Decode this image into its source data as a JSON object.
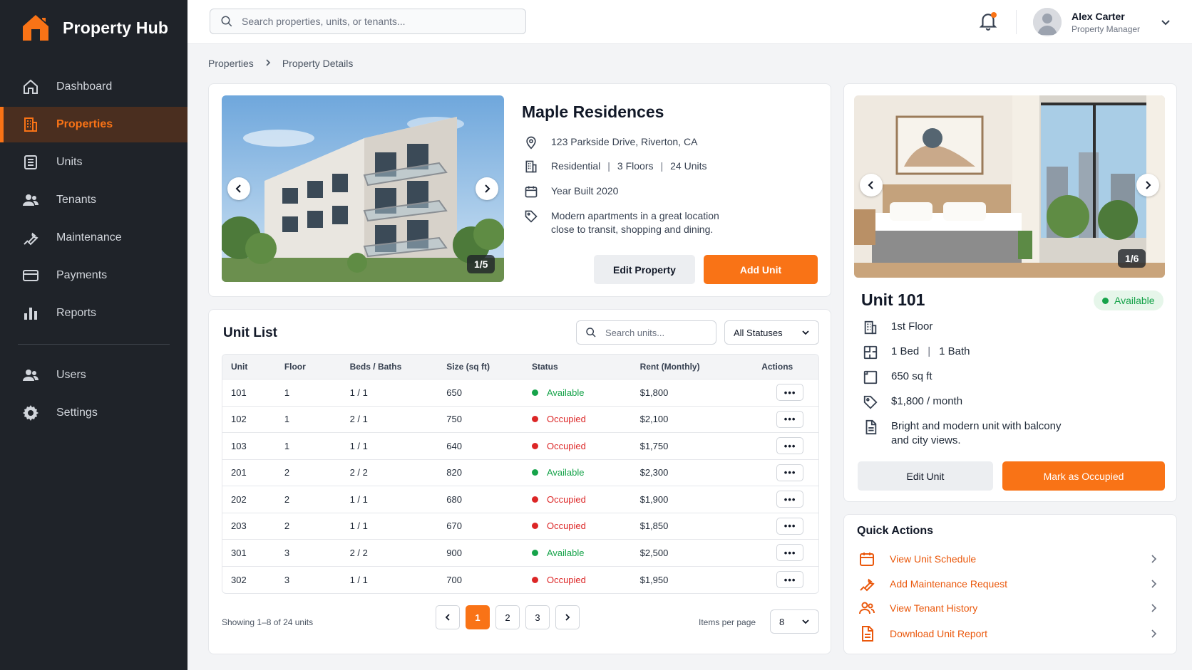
{
  "app": {
    "name": "Property Hub",
    "accent": "#f97316"
  },
  "sidebar": {
    "items": [
      {
        "label": "Dashboard",
        "icon": "home-icon"
      },
      {
        "label": "Properties",
        "icon": "building-icon",
        "active": true
      },
      {
        "label": "Units",
        "icon": "units-icon"
      },
      {
        "label": "Tenants",
        "icon": "tenants-icon"
      },
      {
        "label": "Maintenance",
        "icon": "wrench-icon"
      },
      {
        "label": "Payments",
        "icon": "credit-card-icon"
      },
      {
        "label": "Reports",
        "icon": "bar-chart-icon"
      }
    ],
    "secondary": [
      {
        "label": "Users",
        "icon": "users-icon"
      },
      {
        "label": "Settings",
        "icon": "gear-icon"
      }
    ]
  },
  "topbar": {
    "search_placeholder": "Search properties, units, or tenants...",
    "user": {
      "name": "Alex Carter",
      "role": "Property Manager"
    }
  },
  "breadcrumb": {
    "parent": "Properties",
    "current": "Property Details"
  },
  "property": {
    "name": "Maple Residences",
    "address": "123 Parkside Drive, Riverton, CA",
    "type": "Residential",
    "floors": "3 Floors",
    "units": "24 Units",
    "year_built": "Year Built 2020",
    "description_line1": "Modern apartments in a great location",
    "description_line2": "close to transit, shopping and dining.",
    "photo_counter": "1/5",
    "edit_label": "Edit Property",
    "add_unit_label": "Add Unit"
  },
  "unit_list": {
    "title": "Unit List",
    "search_placeholder": "Search units...",
    "status_filter": "All Statuses",
    "columns": [
      "Unit",
      "Floor",
      "Beds / Baths",
      "Size (sq ft)",
      "Status",
      "Rent (Monthly)",
      "Actions"
    ],
    "rows": [
      {
        "unit": "101",
        "floor": "1",
        "beds_baths": "1 / 1",
        "size": "650",
        "status": "Available",
        "rent": "$1,800"
      },
      {
        "unit": "102",
        "floor": "1",
        "beds_baths": "2 / 1",
        "size": "750",
        "status": "Occupied",
        "rent": "$2,100"
      },
      {
        "unit": "103",
        "floor": "1",
        "beds_baths": "1 / 1",
        "size": "640",
        "status": "Occupied",
        "rent": "$1,750"
      },
      {
        "unit": "201",
        "floor": "2",
        "beds_baths": "2 / 2",
        "size": "820",
        "status": "Available",
        "rent": "$2,300"
      },
      {
        "unit": "202",
        "floor": "2",
        "beds_baths": "1 / 1",
        "size": "680",
        "status": "Occupied",
        "rent": "$1,900"
      },
      {
        "unit": "203",
        "floor": "2",
        "beds_baths": "1 / 1",
        "size": "670",
        "status": "Occupied",
        "rent": "$1,850"
      },
      {
        "unit": "301",
        "floor": "3",
        "beds_baths": "2 / 2",
        "size": "900",
        "status": "Available",
        "rent": "$2,500"
      },
      {
        "unit": "302",
        "floor": "3",
        "beds_baths": "1 / 1",
        "size": "700",
        "status": "Occupied",
        "rent": "$1,950"
      }
    ],
    "actions_glyph": "•••",
    "showing": "Showing 1–8 of 24 units",
    "pages": [
      "1",
      "2",
      "3"
    ],
    "current_page": "1",
    "items_per_page_label": "Items per page",
    "items_per_page": "8",
    "status_colors": {
      "Available": "#16a34a",
      "Occupied": "#dc2626"
    }
  },
  "unit_detail": {
    "title": "Unit 101",
    "status": "Available",
    "photo_counter": "1/6",
    "floor": "1st Floor",
    "beds": "1 Bed",
    "baths": "1 Bath",
    "size": "650 sq ft",
    "rent": "$1,800 / month",
    "description_line1": "Bright and modern unit with balcony",
    "description_line2": "and city views.",
    "edit_label": "Edit Unit",
    "mark_label": "Mark as Occupied"
  },
  "quick_actions": {
    "title": "Quick Actions",
    "items": [
      {
        "label": "View Unit Schedule",
        "icon": "calendar-icon"
      },
      {
        "label": "Add Maintenance Request",
        "icon": "wrench-icon"
      },
      {
        "label": "View Tenant History",
        "icon": "tenants-icon"
      },
      {
        "label": "Download Unit Report",
        "icon": "document-icon"
      }
    ]
  }
}
